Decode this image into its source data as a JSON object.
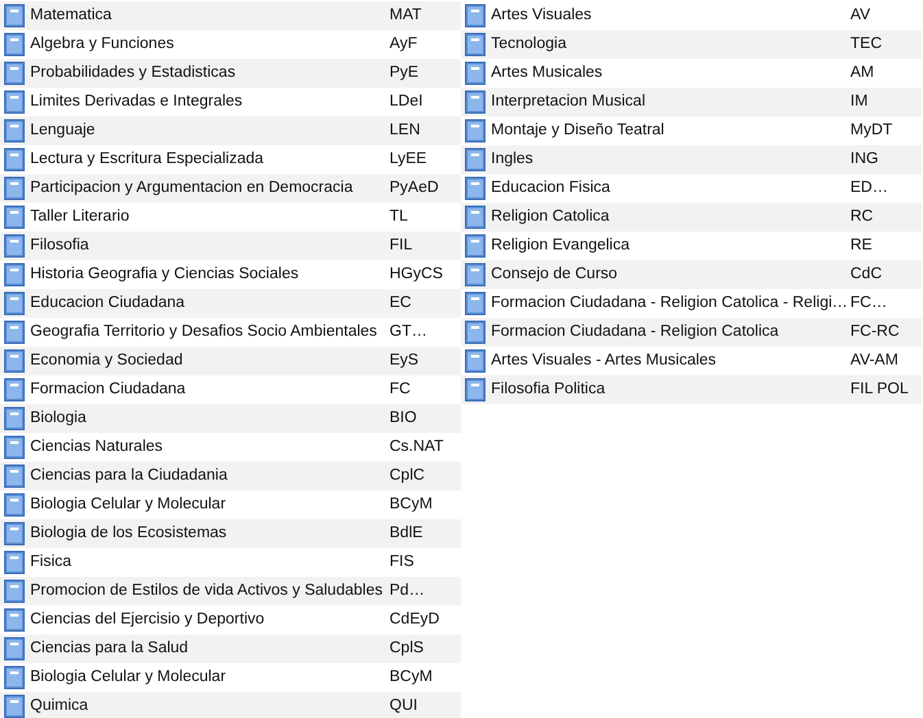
{
  "columns": [
    {
      "items": [
        {
          "name": "Matematica",
          "code": "MAT"
        },
        {
          "name": "Algebra y Funciones",
          "code": "AyF"
        },
        {
          "name": "Probabilidades y Estadisticas",
          "code": "PyE"
        },
        {
          "name": "Limites Derivadas e Integrales",
          "code": "LDeI"
        },
        {
          "name": "Lenguaje",
          "code": "LEN"
        },
        {
          "name": "Lectura y Escritura Especializada",
          "code": "LyEE"
        },
        {
          "name": "Participacion y Argumentacion en Democracia",
          "code": "PyAeD"
        },
        {
          "name": "Taller Literario",
          "code": "TL"
        },
        {
          "name": "Filosofia",
          "code": "FIL"
        },
        {
          "name": "Historia Geografia y Ciencias Sociales",
          "code": "HGyCS"
        },
        {
          "name": "Educacion Ciudadana",
          "code": "EC"
        },
        {
          "name": "Geografia Territorio y Desafios Socio Ambientales",
          "code": "GT…"
        },
        {
          "name": "Economia y Sociedad",
          "code": "EyS"
        },
        {
          "name": "Formacion Ciudadana",
          "code": "FC"
        },
        {
          "name": "Biologia",
          "code": "BIO"
        },
        {
          "name": "Ciencias Naturales",
          "code": "Cs.NAT"
        },
        {
          "name": "Ciencias para la Ciudadania",
          "code": "CplC"
        },
        {
          "name": "Biologia Celular y Molecular",
          "code": "BCyM"
        },
        {
          "name": "Biologia de los Ecosistemas",
          "code": "BdlE"
        },
        {
          "name": "Fisica",
          "code": "FIS"
        },
        {
          "name": "Promocion de Estilos de vida Activos y Saludables",
          "code": "Pd…"
        },
        {
          "name": "Ciencias del Ejercisio y Deportivo",
          "code": "CdEyD"
        },
        {
          "name": "Ciencias para la Salud",
          "code": "CplS"
        },
        {
          "name": "Biologia Celular y Molecular",
          "code": "BCyM"
        },
        {
          "name": "Quimica",
          "code": "QUI"
        }
      ]
    },
    {
      "items": [
        {
          "name": "Artes Visuales",
          "code": "AV"
        },
        {
          "name": "Tecnologia",
          "code": "TEC"
        },
        {
          "name": "Artes Musicales",
          "code": "AM"
        },
        {
          "name": "Interpretacion Musical",
          "code": "IM"
        },
        {
          "name": "Montaje y Diseño Teatral",
          "code": "MyDT"
        },
        {
          "name": "Ingles",
          "code": "ING"
        },
        {
          "name": "Educacion Fisica",
          "code": "ED…"
        },
        {
          "name": "Religion Catolica",
          "code": "RC"
        },
        {
          "name": "Religion Evangelica",
          "code": "RE"
        },
        {
          "name": "Consejo de Curso",
          "code": "CdC"
        },
        {
          "name": "Formacion Ciudadana - Religion Catolica - Religi…",
          "code": "FC…"
        },
        {
          "name": "Formacion Ciudadana - Religion Catolica",
          "code": "FC-RC"
        },
        {
          "name": "Artes Visuales - Artes Musicales",
          "code": "AV-AM"
        },
        {
          "name": "Filosofia Politica",
          "code": "FIL POL"
        }
      ]
    }
  ]
}
